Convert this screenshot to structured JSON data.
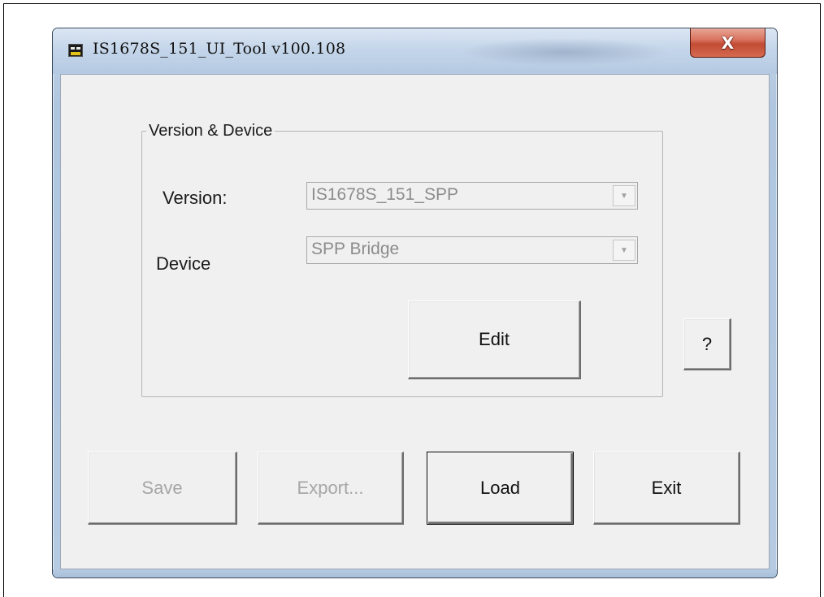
{
  "window": {
    "title": "IS1678S_151_UI_Tool v100.108",
    "close_label": "X"
  },
  "group": {
    "title": "Version & Device",
    "version_label": "Version:",
    "version_value": "IS1678S_151_SPP",
    "device_label": "Device",
    "device_value": "SPP Bridge",
    "edit_label": "Edit"
  },
  "help_label": "?",
  "buttons": {
    "save": "Save",
    "export": "Export...",
    "load": "Load",
    "exit": "Exit"
  },
  "icons": {
    "app": "app-icon",
    "close": "close-icon",
    "dropdown": "chevron-down-icon"
  }
}
